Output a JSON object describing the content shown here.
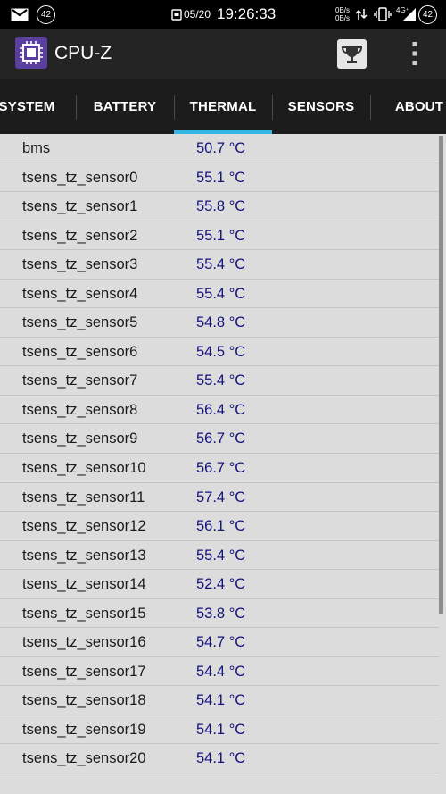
{
  "status_bar": {
    "badge_left": "42",
    "date": "05/20",
    "time": "19:26:33",
    "net_up": "0B/s",
    "net_down": "0B/s",
    "signal": "4G⁺",
    "battery": "42"
  },
  "app": {
    "title": "CPU-Z",
    "accent_color": "#33b5e5",
    "logo_color": "#5a3ea0"
  },
  "tabs": [
    {
      "label": "SYSTEM",
      "active": false
    },
    {
      "label": "BATTERY",
      "active": false
    },
    {
      "label": "THERMAL",
      "active": true
    },
    {
      "label": "SENSORS",
      "active": false
    },
    {
      "label": "ABOUT",
      "active": false
    }
  ],
  "thermal": {
    "rows": [
      {
        "name": "bms",
        "value": "50.7 °C"
      },
      {
        "name": "tsens_tz_sensor0",
        "value": "55.1 °C"
      },
      {
        "name": "tsens_tz_sensor1",
        "value": "55.8 °C"
      },
      {
        "name": "tsens_tz_sensor2",
        "value": "55.1 °C"
      },
      {
        "name": "tsens_tz_sensor3",
        "value": "55.4 °C"
      },
      {
        "name": "tsens_tz_sensor4",
        "value": "55.4 °C"
      },
      {
        "name": "tsens_tz_sensor5",
        "value": "54.8 °C"
      },
      {
        "name": "tsens_tz_sensor6",
        "value": "54.5 °C"
      },
      {
        "name": "tsens_tz_sensor7",
        "value": "55.4 °C"
      },
      {
        "name": "tsens_tz_sensor8",
        "value": "56.4 °C"
      },
      {
        "name": "tsens_tz_sensor9",
        "value": "56.7 °C"
      },
      {
        "name": "tsens_tz_sensor10",
        "value": "56.7 °C"
      },
      {
        "name": "tsens_tz_sensor11",
        "value": "57.4 °C"
      },
      {
        "name": "tsens_tz_sensor12",
        "value": "56.1 °C"
      },
      {
        "name": "tsens_tz_sensor13",
        "value": "55.4 °C"
      },
      {
        "name": "tsens_tz_sensor14",
        "value": "52.4 °C"
      },
      {
        "name": "tsens_tz_sensor15",
        "value": "53.8 °C"
      },
      {
        "name": "tsens_tz_sensor16",
        "value": "54.7 °C"
      },
      {
        "name": "tsens_tz_sensor17",
        "value": "54.4 °C"
      },
      {
        "name": "tsens_tz_sensor18",
        "value": "54.1 °C"
      },
      {
        "name": "tsens_tz_sensor19",
        "value": "54.1 °C"
      },
      {
        "name": "tsens_tz_sensor20",
        "value": "54.1 °C"
      }
    ]
  }
}
